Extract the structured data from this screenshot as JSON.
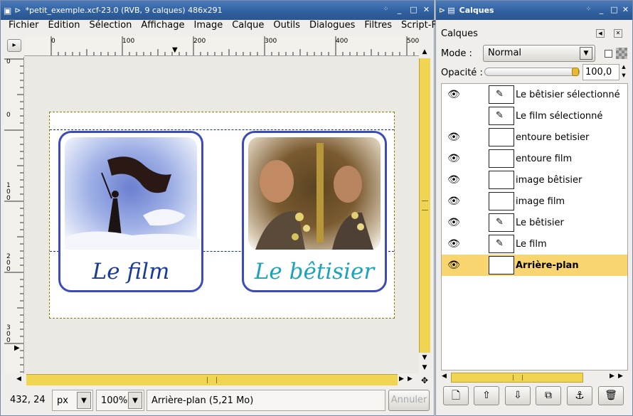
{
  "image_window": {
    "title": "*petit_exemple.xcf-23.0 (RVB, 9 calques) 486x291",
    "menu": [
      "Fichier",
      "Édition",
      "Sélection",
      "Affichage",
      "Image",
      "Calque",
      "Outils",
      "Dialogues",
      "Filtres",
      "Script-Fu"
    ],
    "ruler_h_labels": [
      "0",
      "100",
      "200",
      "300",
      "400",
      "500"
    ],
    "ruler_v_labels": [
      "0",
      "0",
      "1 0 0",
      "2 0 0",
      "3 0 0"
    ],
    "canvas": {
      "card1_caption": "Le film",
      "card2_caption": "Le bêtisier",
      "card1_color": "#1a3b96",
      "card2_color": "#1aa3b9"
    },
    "status": {
      "coords": "432, 24",
      "unit": "px",
      "zoom": "100%",
      "message": "Arrière-plan (5,21 Mo)",
      "cancel_label": "Annuler"
    }
  },
  "layers_window": {
    "title": "Calques",
    "header": "Calques",
    "mode_label": "Mode :",
    "mode_value": "Normal",
    "opacity_label": "Opacité :",
    "opacity_value": "100,0",
    "opacity_level": 1.0,
    "layers": [
      {
        "name": "Le bêtisier sélectionné",
        "visible": true,
        "thumb": "text"
      },
      {
        "name": "Le film sélectionné",
        "visible": false,
        "thumb": "text"
      },
      {
        "name": "entoure betisier",
        "visible": true,
        "thumb": "checker"
      },
      {
        "name": "entoure film",
        "visible": true,
        "thumb": "checker"
      },
      {
        "name": "image bêtisier",
        "visible": true,
        "thumb": "checker"
      },
      {
        "name": "image film",
        "visible": true,
        "thumb": "checker"
      },
      {
        "name": "Le bêtisier",
        "visible": true,
        "thumb": "text"
      },
      {
        "name": "Le film",
        "visible": true,
        "thumb": "text"
      },
      {
        "name": "Arrière-plan",
        "visible": true,
        "thumb": "white",
        "selected": true
      }
    ],
    "buttons": [
      "new-layer-icon",
      "raise-layer-icon",
      "lower-layer-icon",
      "duplicate-layer-icon",
      "anchor-layer-icon",
      "delete-layer-icon"
    ],
    "selection_color": "#f8d56e"
  }
}
